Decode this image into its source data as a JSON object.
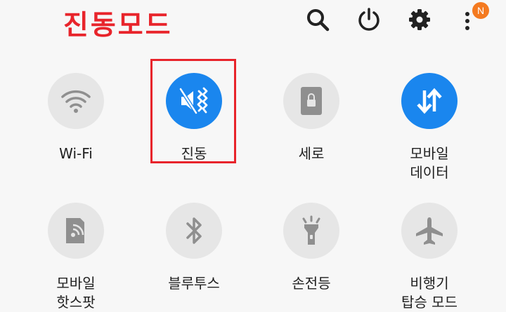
{
  "header": {
    "title": "진동모드",
    "title_color": "#e8242b",
    "icons": [
      "search-icon",
      "power-icon",
      "settings-icon",
      "more-icon"
    ],
    "notification_badge": "N",
    "badge_color": "#f47a20"
  },
  "tiles": [
    {
      "label_lines": [
        "Wi-Fi"
      ],
      "icon": "wifi-icon",
      "active": false
    },
    {
      "label_lines": [
        "진동"
      ],
      "icon": "vibrate-icon",
      "active": true,
      "highlighted": true
    },
    {
      "label_lines": [
        "세로"
      ],
      "icon": "portrait-lock-icon",
      "active": false
    },
    {
      "label_lines": [
        "모바일",
        "데이터"
      ],
      "icon": "mobile-data-icon",
      "active": true
    },
    {
      "label_lines": [
        "모바일",
        "핫스팟"
      ],
      "icon": "hotspot-icon",
      "active": false
    },
    {
      "label_lines": [
        "블루투스"
      ],
      "icon": "bluetooth-icon",
      "active": false
    },
    {
      "label_lines": [
        "손전등"
      ],
      "icon": "flashlight-icon",
      "active": false
    },
    {
      "label_lines": [
        "비행기",
        "탑승 모드"
      ],
      "icon": "airplane-icon",
      "active": false
    }
  ],
  "colors": {
    "active": "#1a86ee",
    "inactive": "#e6e6e6",
    "inactive_icon": "#8f8f8f",
    "highlight": "#e8242b"
  }
}
